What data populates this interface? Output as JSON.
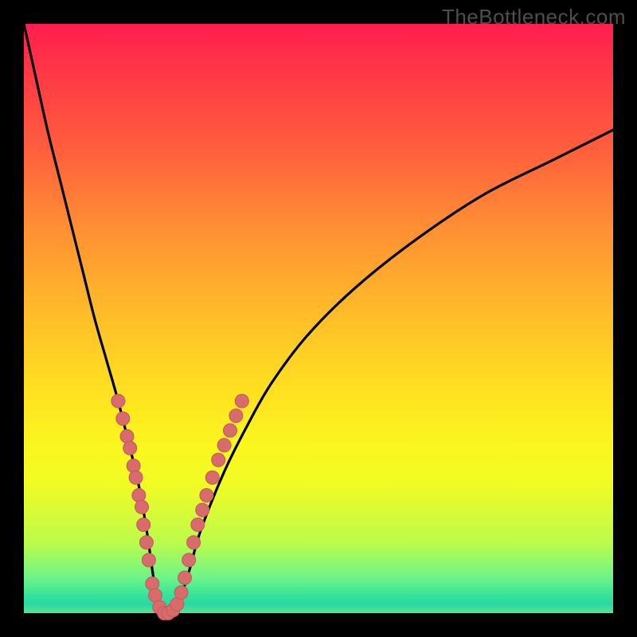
{
  "watermark": "TheBottleneck.com",
  "colors": {
    "frame": "#000000",
    "curve": "#000000",
    "marker_fill": "#d86b6b",
    "marker_stroke": "#c25a5a"
  },
  "chart_data": {
    "type": "line",
    "title": "",
    "xlabel": "",
    "ylabel": "",
    "xlim": [
      0,
      100
    ],
    "ylim": [
      0,
      100
    ],
    "series": [
      {
        "name": "bottleneck-curve",
        "x": [
          0,
          2,
          4,
          6,
          8,
          10,
          12,
          14,
          16,
          18,
          19,
          20,
          21,
          22,
          23,
          24,
          25,
          26,
          28,
          30,
          34,
          38,
          42,
          48,
          56,
          66,
          78,
          90,
          100
        ],
        "y": [
          100,
          91,
          82,
          74,
          66,
          58,
          50,
          43,
          36,
          28,
          24,
          19,
          13,
          6,
          1,
          0,
          0,
          1,
          7,
          14,
          24,
          32,
          39,
          47,
          55,
          63,
          71,
          77,
          82
        ]
      }
    ],
    "markers": {
      "name": "highlight-dots",
      "points": [
        {
          "x": 16.0,
          "y": 36
        },
        {
          "x": 16.8,
          "y": 33
        },
        {
          "x": 17.5,
          "y": 30
        },
        {
          "x": 18.0,
          "y": 28
        },
        {
          "x": 18.6,
          "y": 25
        },
        {
          "x": 19.0,
          "y": 23
        },
        {
          "x": 19.5,
          "y": 20
        },
        {
          "x": 20.0,
          "y": 18
        },
        {
          "x": 20.3,
          "y": 15
        },
        {
          "x": 20.8,
          "y": 12
        },
        {
          "x": 21.2,
          "y": 9
        },
        {
          "x": 21.8,
          "y": 5
        },
        {
          "x": 22.3,
          "y": 3
        },
        {
          "x": 23.0,
          "y": 1
        },
        {
          "x": 23.8,
          "y": 0
        },
        {
          "x": 24.5,
          "y": 0
        },
        {
          "x": 25.3,
          "y": 0.5
        },
        {
          "x": 26.0,
          "y": 1.5
        },
        {
          "x": 26.7,
          "y": 3.5
        },
        {
          "x": 27.3,
          "y": 6
        },
        {
          "x": 28.0,
          "y": 9
        },
        {
          "x": 28.8,
          "y": 12
        },
        {
          "x": 29.5,
          "y": 15
        },
        {
          "x": 30.3,
          "y": 17.5
        },
        {
          "x": 31.0,
          "y": 20
        },
        {
          "x": 32.0,
          "y": 23
        },
        {
          "x": 33.0,
          "y": 26
        },
        {
          "x": 34.0,
          "y": 28.5
        },
        {
          "x": 35.0,
          "y": 31
        },
        {
          "x": 36.0,
          "y": 33.5
        },
        {
          "x": 37.0,
          "y": 36
        }
      ]
    }
  }
}
